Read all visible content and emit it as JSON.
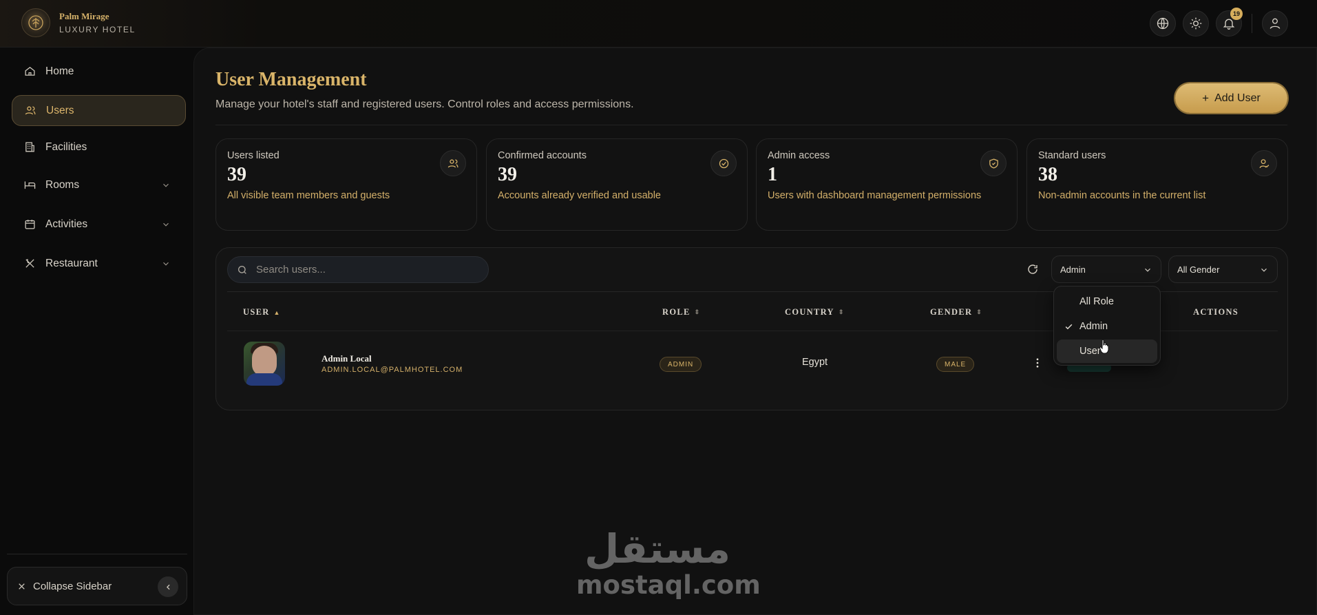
{
  "brand": {
    "name": "Palm Mirage",
    "subtitle": "LUXURY HOTEL"
  },
  "topbar": {
    "icons": [
      "globe-icon",
      "sun-icon",
      "bell-icon",
      "user-icon"
    ],
    "notification_count": "19"
  },
  "sidebar": {
    "items": [
      {
        "label": "Home",
        "icon": "home-icon",
        "active": false,
        "expandable": false
      },
      {
        "label": "Users",
        "icon": "users-icon",
        "active": true,
        "expandable": false
      },
      {
        "label": "Facilities",
        "icon": "building-icon",
        "active": false,
        "expandable": false
      },
      {
        "label": "Rooms",
        "icon": "bed-icon",
        "active": false,
        "expandable": true
      },
      {
        "label": "Activities",
        "icon": "calendar-icon",
        "active": false,
        "expandable": true
      },
      {
        "label": "Restaurant",
        "icon": "utensils-icon",
        "active": false,
        "expandable": true
      }
    ],
    "collapse_label": "Collapse Sidebar"
  },
  "page": {
    "title": "User Management",
    "subtitle": "Manage your hotel's staff and registered users. Control roles and access permissions.",
    "add_button": "Add User"
  },
  "stats": [
    {
      "label": "Users listed",
      "value": "39",
      "desc": "All visible team members and guests",
      "icon": "users-icon"
    },
    {
      "label": "Confirmed accounts",
      "value": "39",
      "desc": "Accounts already verified and usable",
      "icon": "check-circle-icon"
    },
    {
      "label": "Admin access",
      "value": "1",
      "desc": "Users with dashboard management permissions",
      "icon": "shield-icon"
    },
    {
      "label": "Standard users",
      "value": "38",
      "desc": "Non-admin accounts in the current list",
      "icon": "user-check-icon"
    }
  ],
  "filters": {
    "search_placeholder": "Search users...",
    "role_value": "Admin",
    "gender_value": "All Gender",
    "role_options": [
      "All Role",
      "Admin",
      "User"
    ],
    "role_selected": "Admin"
  },
  "table": {
    "columns": [
      "USER",
      "ROLE",
      "COUNTRY",
      "GENDER",
      "ACTIONS"
    ],
    "rows": [
      {
        "name": "Admin Local",
        "email": "ADMIN.LOCAL@PALMHOTEL.COM",
        "role": "ADMIN",
        "country": "Egypt",
        "gender": "MALE"
      }
    ]
  },
  "watermark": {
    "arabic": "مستقل",
    "latin": "mostaql.com"
  },
  "colors": {
    "accent": "#d9b469",
    "background": "#0b0b0b",
    "panel": "#141414"
  }
}
